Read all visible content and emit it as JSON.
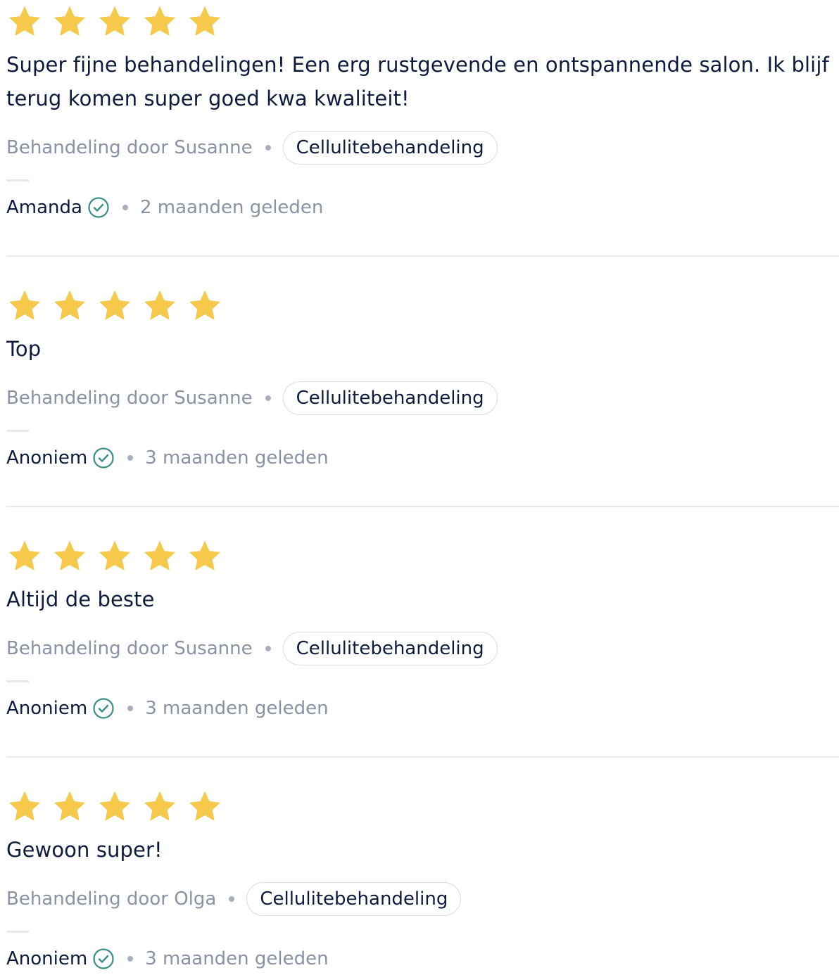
{
  "colors": {
    "star": "#f6c84c",
    "text": "#0f1b3d",
    "muted": "#8a93a4",
    "verified": "#3b8f86"
  },
  "reviews": [
    {
      "rating": 5,
      "text": "Super fijne behandelingen! Een erg rustgevende en ontspannende salon. Ik blijf terug komen super goed kwa kwaliteit!",
      "treated_by": "Behandeling door Susanne",
      "treatment": "Cellulitebehandeling",
      "author": "Amanda",
      "when": "2 maanden geleden"
    },
    {
      "rating": 5,
      "text": "Top",
      "treated_by": "Behandeling door Susanne",
      "treatment": "Cellulitebehandeling",
      "author": "Anoniem",
      "when": "3 maanden geleden"
    },
    {
      "rating": 5,
      "text": "Altijd de beste",
      "treated_by": "Behandeling door Susanne",
      "treatment": "Cellulitebehandeling",
      "author": "Anoniem",
      "when": "3 maanden geleden"
    },
    {
      "rating": 5,
      "text": "Gewoon super!",
      "treated_by": "Behandeling door Olga",
      "treatment": "Cellulitebehandeling",
      "author": "Anoniem",
      "when": "3 maanden geleden"
    }
  ]
}
